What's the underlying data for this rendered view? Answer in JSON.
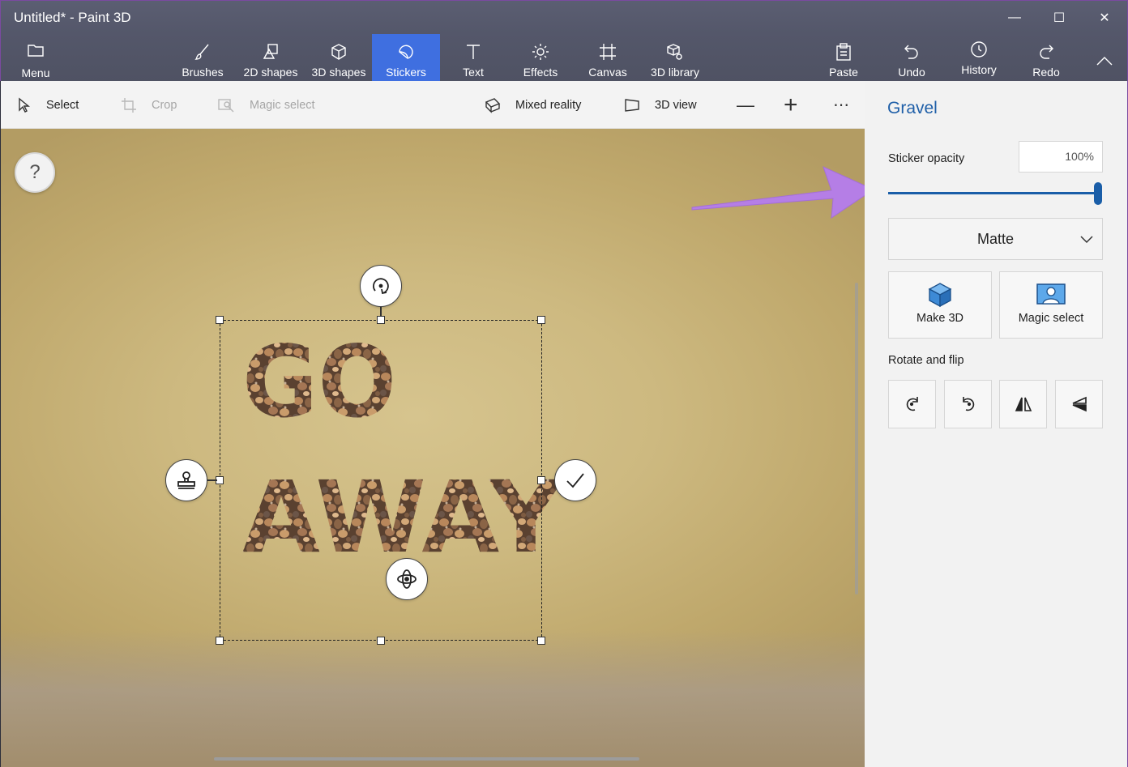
{
  "window": {
    "title": "Untitled* - Paint 3D",
    "minimize": "—",
    "maximize": "☐",
    "close": "✕"
  },
  "menu": {
    "label": "Menu"
  },
  "tools": [
    {
      "label": "Brushes"
    },
    {
      "label": "2D shapes"
    },
    {
      "label": "3D shapes"
    },
    {
      "label": "Stickers",
      "active": true
    },
    {
      "label": "Text"
    },
    {
      "label": "Effects"
    },
    {
      "label": "Canvas"
    },
    {
      "label": "3D library"
    }
  ],
  "actions": {
    "paste": "Paste",
    "undo": "Undo",
    "history": "History",
    "redo": "Redo"
  },
  "subtoolbar": {
    "select": "Select",
    "crop": "Crop",
    "magic_select": "Magic select",
    "mixed_reality": "Mixed reality",
    "view_3d": "3D view",
    "zoom_out": "—",
    "zoom_in": "+",
    "more": "⋯"
  },
  "canvas": {
    "help": "?",
    "sticker_lines": [
      "GO",
      "AWAY"
    ]
  },
  "panel": {
    "title": "Gravel",
    "opacity_label": "Sticker opacity",
    "opacity_value": "100%",
    "opacity_level": 1.0,
    "finish": "Matte",
    "make_3d": "Make 3D",
    "magic_select": "Magic select",
    "rotate_flip_label": "Rotate and flip"
  },
  "colors": {
    "ribbon": "#54576a",
    "active_tool": "#3f6fe0",
    "accent_blue": "#1a5ea8",
    "annotation_arrow": "#b57ee6",
    "canvas_bg": "#cdb980"
  }
}
